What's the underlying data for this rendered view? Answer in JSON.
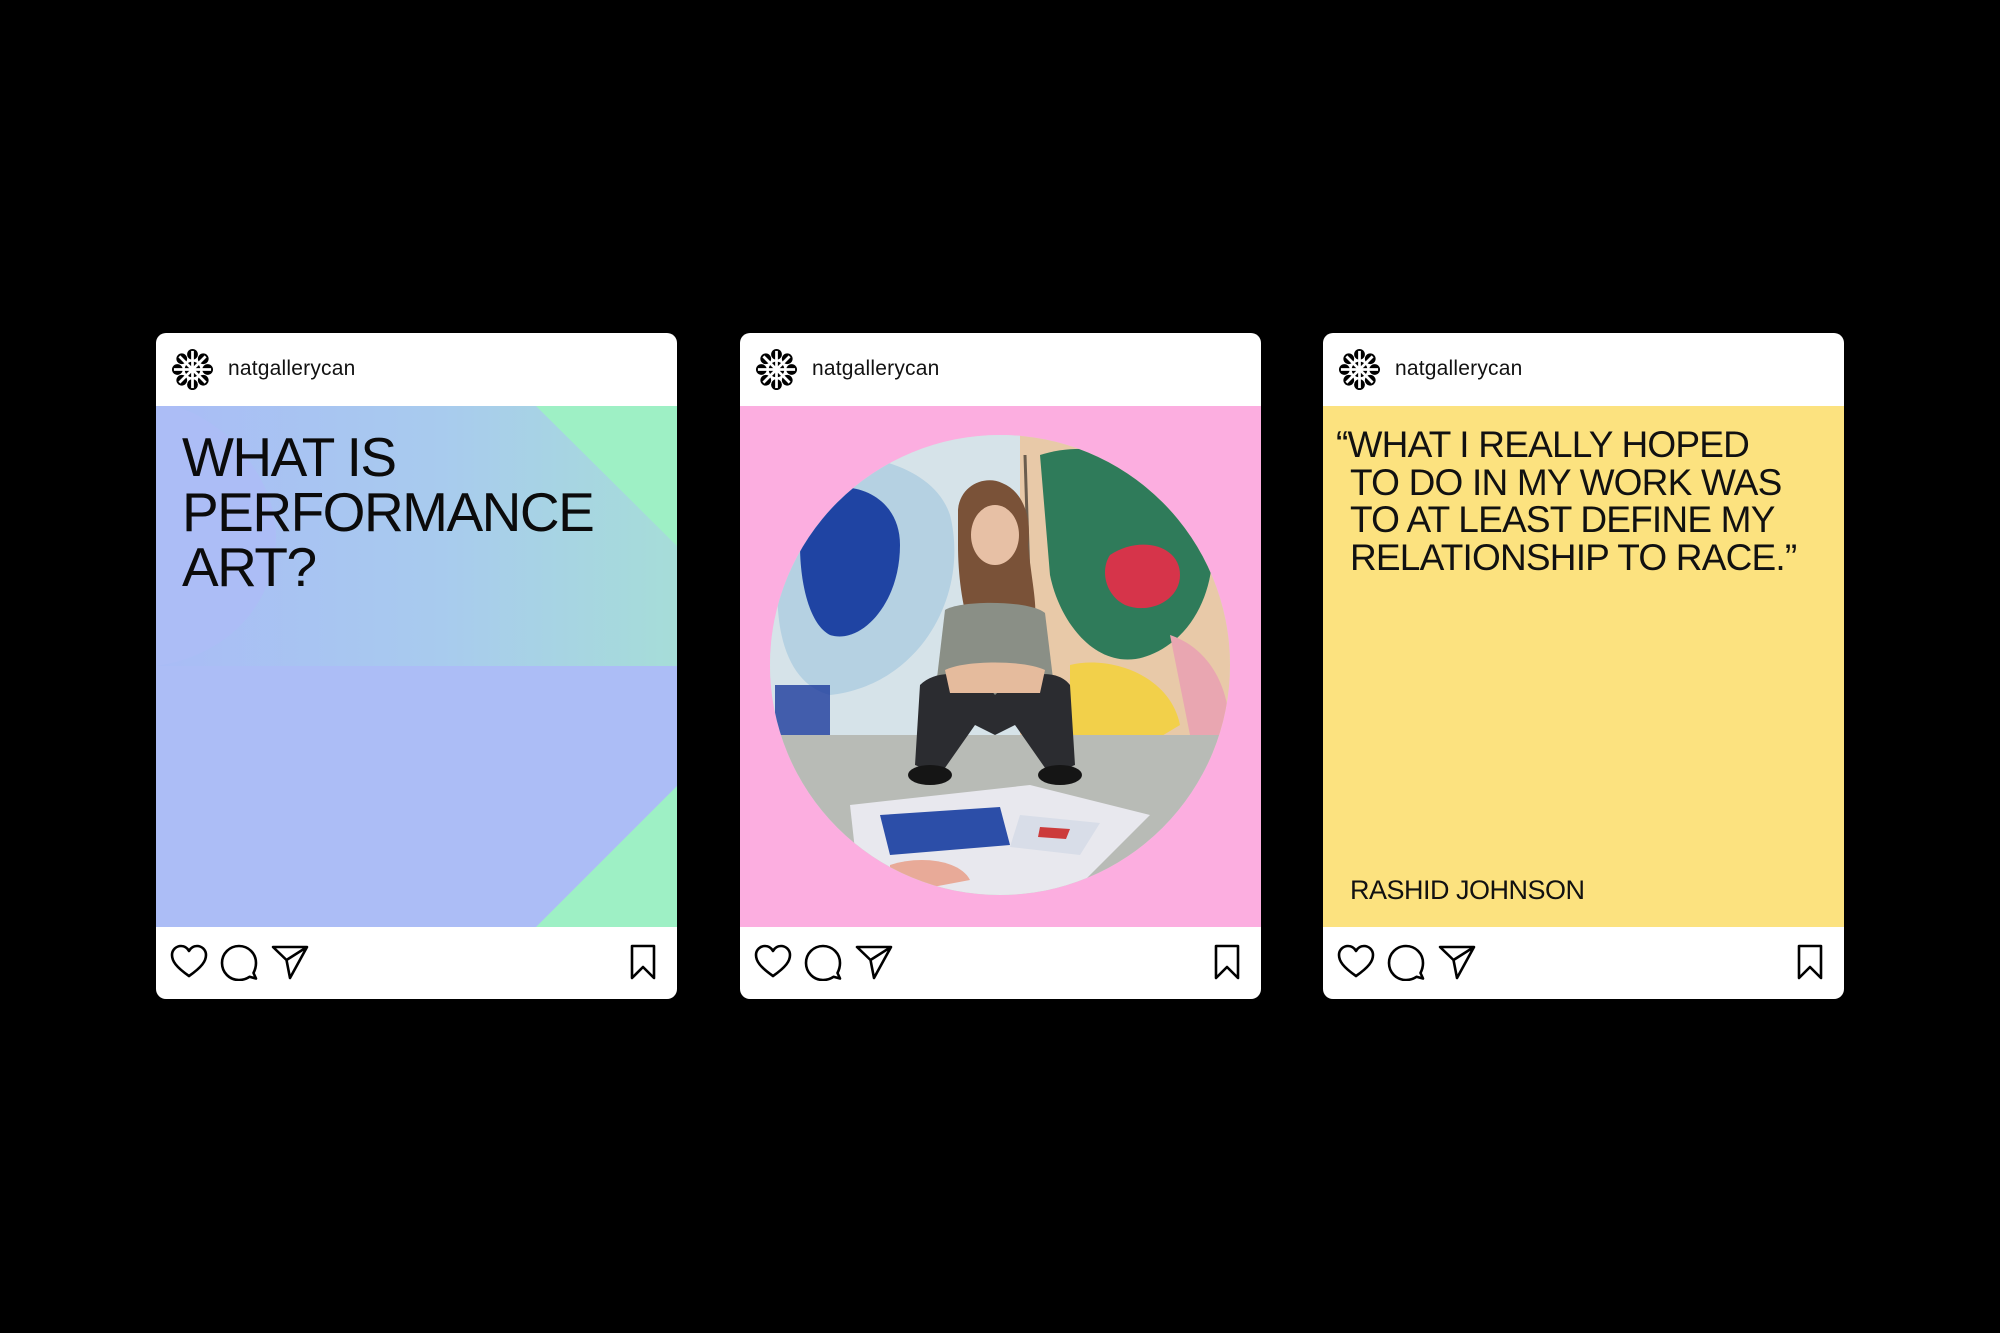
{
  "posts": [
    {
      "username": "natgallerycan",
      "headline_lines": [
        "WHAT IS",
        "PERFORMANCE",
        "ART?"
      ],
      "colors": {
        "background": "#acbdf6",
        "accent": "#9ef0c5"
      }
    },
    {
      "username": "natgallerycan",
      "image": "artist-portrait-in-studio",
      "colors": {
        "background": "#fcaee0"
      }
    },
    {
      "username": "natgallerycan",
      "quote_lines": [
        "“WHAT I REALLY HOPED",
        "TO DO IN MY WORK WAS",
        "TO AT LEAST DEFINE MY",
        "RELATIONSHIP TO RACE.”"
      ],
      "author": "RASHID JOHNSON",
      "colors": {
        "background": "#fce27f"
      }
    }
  ],
  "icons": {
    "avatar": "gallery-logo-icon",
    "like": "heart-icon",
    "comment": "comment-icon",
    "share": "send-icon",
    "save": "bookmark-icon"
  }
}
